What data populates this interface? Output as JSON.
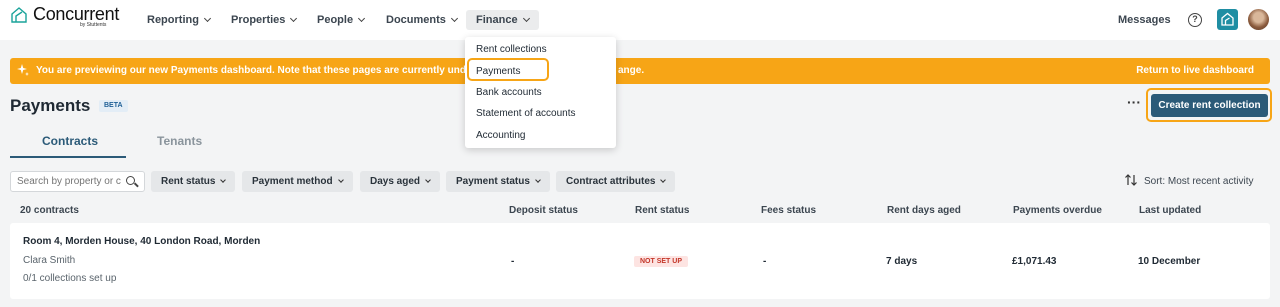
{
  "brand": {
    "name": "Concurrent",
    "sub": "by Stuttents"
  },
  "nav": {
    "items": [
      {
        "label": "Reporting"
      },
      {
        "label": "Properties"
      },
      {
        "label": "People"
      },
      {
        "label": "Documents"
      },
      {
        "label": "Finance",
        "active": true
      }
    ],
    "messages": "Messages",
    "help_glyph": "?"
  },
  "finance_menu": {
    "items": [
      "Rent collections",
      "Payments",
      "Bank accounts",
      "Statement of accounts",
      "Accounting"
    ],
    "highlighted": "Payments"
  },
  "banner": {
    "text": "You are previewing our new Payments dashboard. Note that these pages are currently unde",
    "text_tail": "ange.",
    "link": "Return to live dashboard",
    "color": "#f7a516"
  },
  "page": {
    "title": "Payments",
    "badge": "BETA",
    "more": "···",
    "create_button": "Create rent collection"
  },
  "tabs": [
    {
      "label": "Contracts",
      "active": true
    },
    {
      "label": "Tenants",
      "active": false
    }
  ],
  "search": {
    "placeholder": "Search by property or c"
  },
  "filters": [
    "Rent status",
    "Payment method",
    "Days aged",
    "Payment status",
    "Contract attributes"
  ],
  "sort": {
    "label": "Sort: Most recent activity"
  },
  "table": {
    "count_label": "20 contracts",
    "columns": [
      "Deposit status",
      "Rent status",
      "Fees status",
      "Rent days aged",
      "Payments overdue",
      "Last updated"
    ],
    "rows": [
      {
        "address": "Room 4, Morden House, 40 London Road, Morden",
        "tenant": "Clara Smith",
        "collections": "0/1 collections set up",
        "deposit_status": "-",
        "rent_status": "NOT SET UP",
        "fees_status": "-",
        "rent_days_aged": "7 days",
        "payments_overdue": "£1,071.43",
        "last_updated": "10 December"
      }
    ]
  },
  "colors": {
    "primary": "#2b5a78",
    "accent": "#f7a516",
    "danger": "#c33528"
  }
}
